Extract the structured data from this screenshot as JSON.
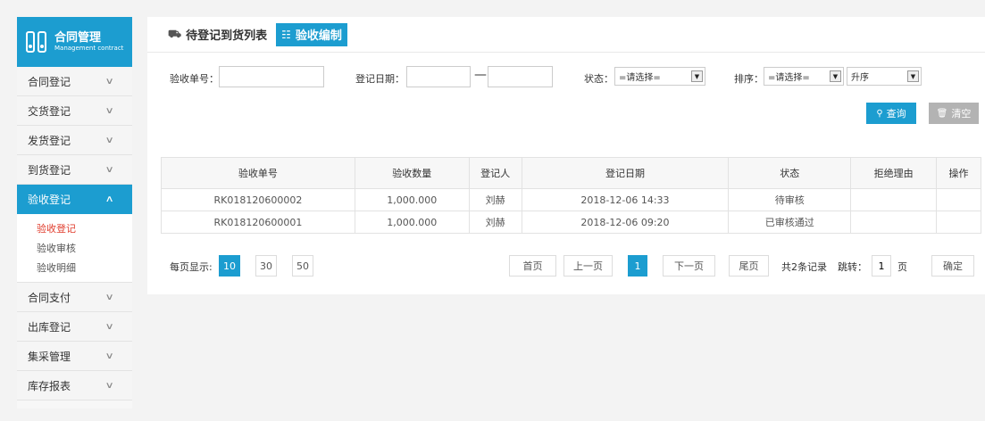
{
  "brand": {
    "title": "合同管理",
    "subtitle": "Management contract"
  },
  "sidebar": {
    "items": [
      {
        "label": "合同登记"
      },
      {
        "label": "交货登记"
      },
      {
        "label": "发货登记"
      },
      {
        "label": "到货登记"
      },
      {
        "label": "验收登记",
        "expanded": true
      },
      {
        "label": "合同支付"
      },
      {
        "label": "出库登记"
      },
      {
        "label": "集采管理"
      },
      {
        "label": "库存报表"
      }
    ],
    "subitems": [
      {
        "label": "验收登记",
        "active": true
      },
      {
        "label": "验收审核"
      },
      {
        "label": "验收明细"
      }
    ]
  },
  "tabs": [
    {
      "label": "待登记到货列表",
      "icon": "truck-icon"
    },
    {
      "label": "验收编制",
      "icon": "list-icon",
      "active": true
    }
  ],
  "filters": {
    "receipt_no_label": "验收单号：",
    "receipt_no_value": "",
    "date_label": "登记日期：",
    "date_from": "",
    "date_sep": "—",
    "date_to": "",
    "status_label": "状态：",
    "status_value": "=请选择=",
    "sort_label": "排序：",
    "sort_field_value": "=请选择=",
    "sort_order_value": "升序"
  },
  "buttons": {
    "query": "查询",
    "clear": "清空"
  },
  "table": {
    "headers": [
      "验收单号",
      "验收数量",
      "登记人",
      "登记日期",
      "状态",
      "拒绝理由",
      "操作"
    ],
    "rows": [
      [
        "RK018120600002",
        "1,000.000",
        "刘赫",
        "2018-12-06 14:33",
        "待审核",
        "",
        ""
      ],
      [
        "RK018120600001",
        "1,000.000",
        "刘赫",
        "2018-12-06 09:20",
        "已审核通过",
        "",
        ""
      ]
    ]
  },
  "pager": {
    "per_page_label": "每页显示:",
    "sizes": [
      "10",
      "30",
      "50"
    ],
    "first": "首页",
    "prev": "上一页",
    "current": "1",
    "next": "下一页",
    "last": "尾页",
    "total": "共2条记录",
    "jump_label": "跳转：",
    "jump_value": "1",
    "page_unit": "页",
    "confirm": "确定"
  },
  "colors": {
    "accent": "#1c9dd0",
    "status_red": "#e02020",
    "sub_active": "#e03c2c"
  }
}
